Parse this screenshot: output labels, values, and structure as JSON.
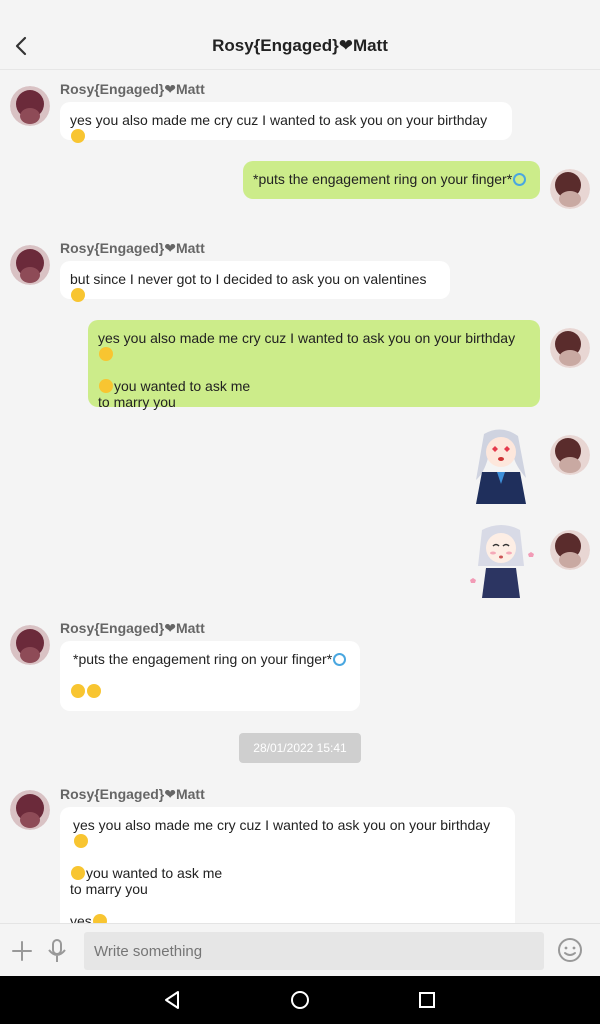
{
  "header": {
    "title": "Rosy{Engaged}❤Matt",
    "back_icon": "chevron-left-icon"
  },
  "messages": [
    {
      "sender": "Rosy{Engaged}❤Matt",
      "text": "yes you also made me cry cuz I wanted to ask you on your birthday"
    },
    {
      "text": "*puts the engagement ring on your finger*"
    },
    {
      "sender": "Rosy{Engaged}❤Matt",
      "text": "but since I never got to I decided to ask you on valentines"
    },
    {
      "line1": "yes you also made me cry cuz I wanted to ask you on your birthday",
      "line2": "you wanted to ask me",
      "line3": "to marry you"
    },
    {
      "sticker": "anime-girl-heart-eyes-sticker"
    },
    {
      "sticker": "anime-girl-blush-sticker"
    },
    {
      "sender": "Rosy{Engaged}❤Matt",
      "text": "*puts the engagement ring on your finger*"
    },
    {
      "sender": "Rosy{Engaged}❤Matt",
      "line1": "yes you also made me cry cuz I wanted to ask you on your birthday",
      "line2": "you wanted to ask me",
      "line3": "to marry you",
      "line4": "yes"
    }
  ],
  "timestamp": "28/01/2022 15:41",
  "composer": {
    "placeholder": "Write something",
    "add_icon": "plus-icon",
    "mic_icon": "microphone-icon",
    "emoji_icon": "smiley-icon"
  },
  "colors": {
    "outgoing_bubble": "#ccec8a",
    "incoming_bubble": "#ffffff",
    "background": "#f4f4f4"
  }
}
